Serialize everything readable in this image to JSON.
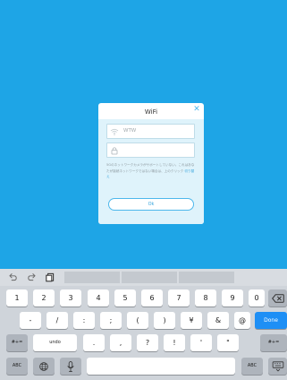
{
  "dialog": {
    "title": "WiFi",
    "close_glyph": "✕",
    "ssid_value": "WTW",
    "password_value": "",
    "note_text": "5Gのネットワークカメラがサポートしていない。これはあなたが接続ネットワークではない場合は、上のクリック",
    "note_link": "切り替え",
    "ok_label": "Ok"
  },
  "toolbar": {
    "icons": [
      "undo-arrow-icon",
      "redo-arrow-icon",
      "clipboard-icon"
    ]
  },
  "keyboard": {
    "row1": [
      "1",
      "2",
      "3",
      "4",
      "5",
      "6",
      "7",
      "8",
      "9",
      "0"
    ],
    "row2": [
      "-",
      "/",
      ":",
      ";",
      "(",
      ")",
      "¥",
      "&",
      "@"
    ],
    "done_label": "Done",
    "row3_left": "#+=",
    "row3_undo": "undo",
    "row3_keys": [
      ".",
      ",",
      "?",
      "!",
      "'",
      "\""
    ],
    "row3_right": "#+=",
    "abc_left": "ABC",
    "abc_right": "ABC"
  },
  "colors": {
    "background": "#1ea5e6",
    "accent": "#4db8ec",
    "done_key": "#1e8ff5"
  }
}
